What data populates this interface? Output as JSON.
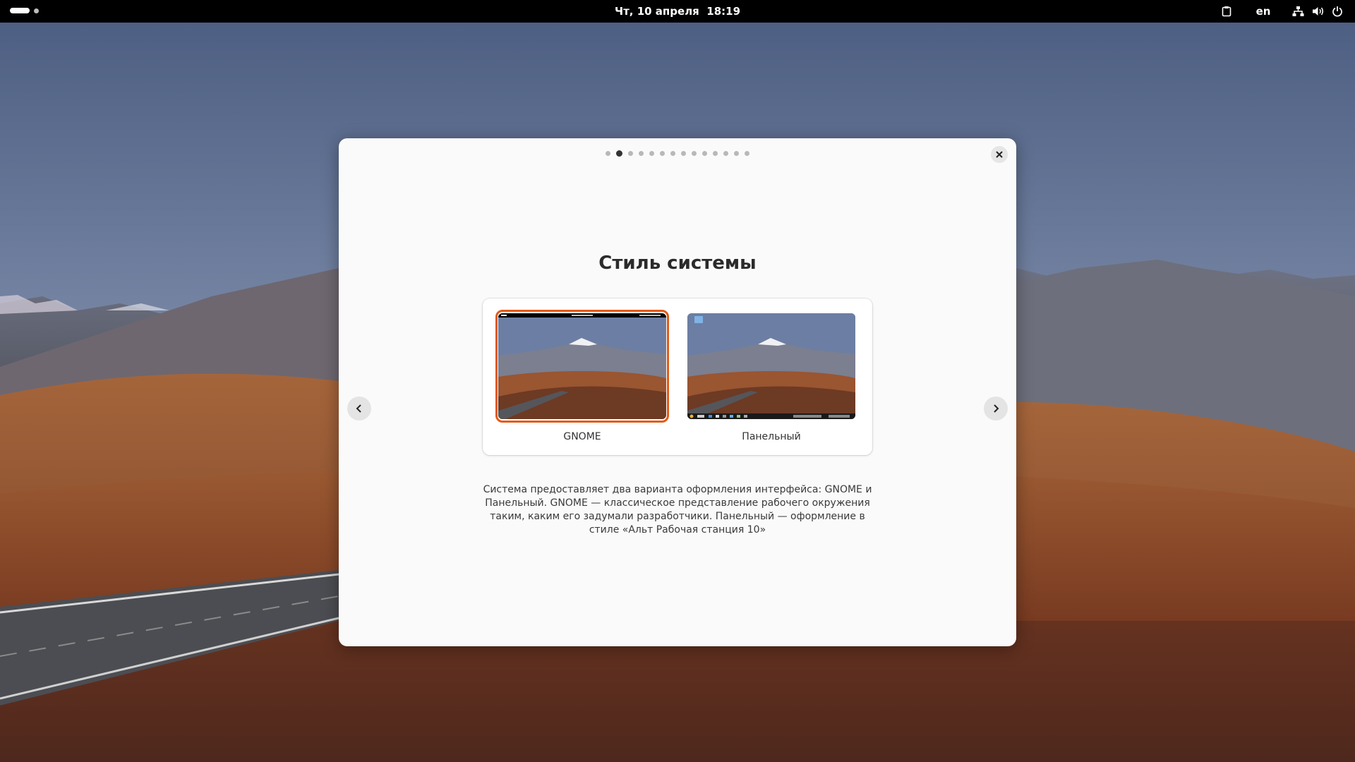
{
  "topbar": {
    "clock": "Чт, 10 апреля  18:19",
    "language": "en",
    "icons": [
      "clipboard-icon",
      "network-icon",
      "volume-icon",
      "power-icon"
    ]
  },
  "dialog": {
    "title": "Стиль системы",
    "page_count": 14,
    "current_page": 2,
    "options": [
      {
        "label": "GNOME",
        "selected": true
      },
      {
        "label": "Панельный",
        "selected": false
      }
    ],
    "description": "Система предоставляет два варианта оформления интерфейса: GNOME и Панельный. GNOME — классическое представление рабочего окружения таким, каким его задумали разработчики. Панельный — оформление в стиле «Альт Рабочая станция 10»",
    "icons": {
      "close": "close-icon",
      "prev": "chevron-left-icon",
      "next": "chevron-right-icon"
    }
  },
  "colors": {
    "accent": "#e35a17",
    "topbar": "#000000",
    "dialog_bg": "#fafafa"
  }
}
